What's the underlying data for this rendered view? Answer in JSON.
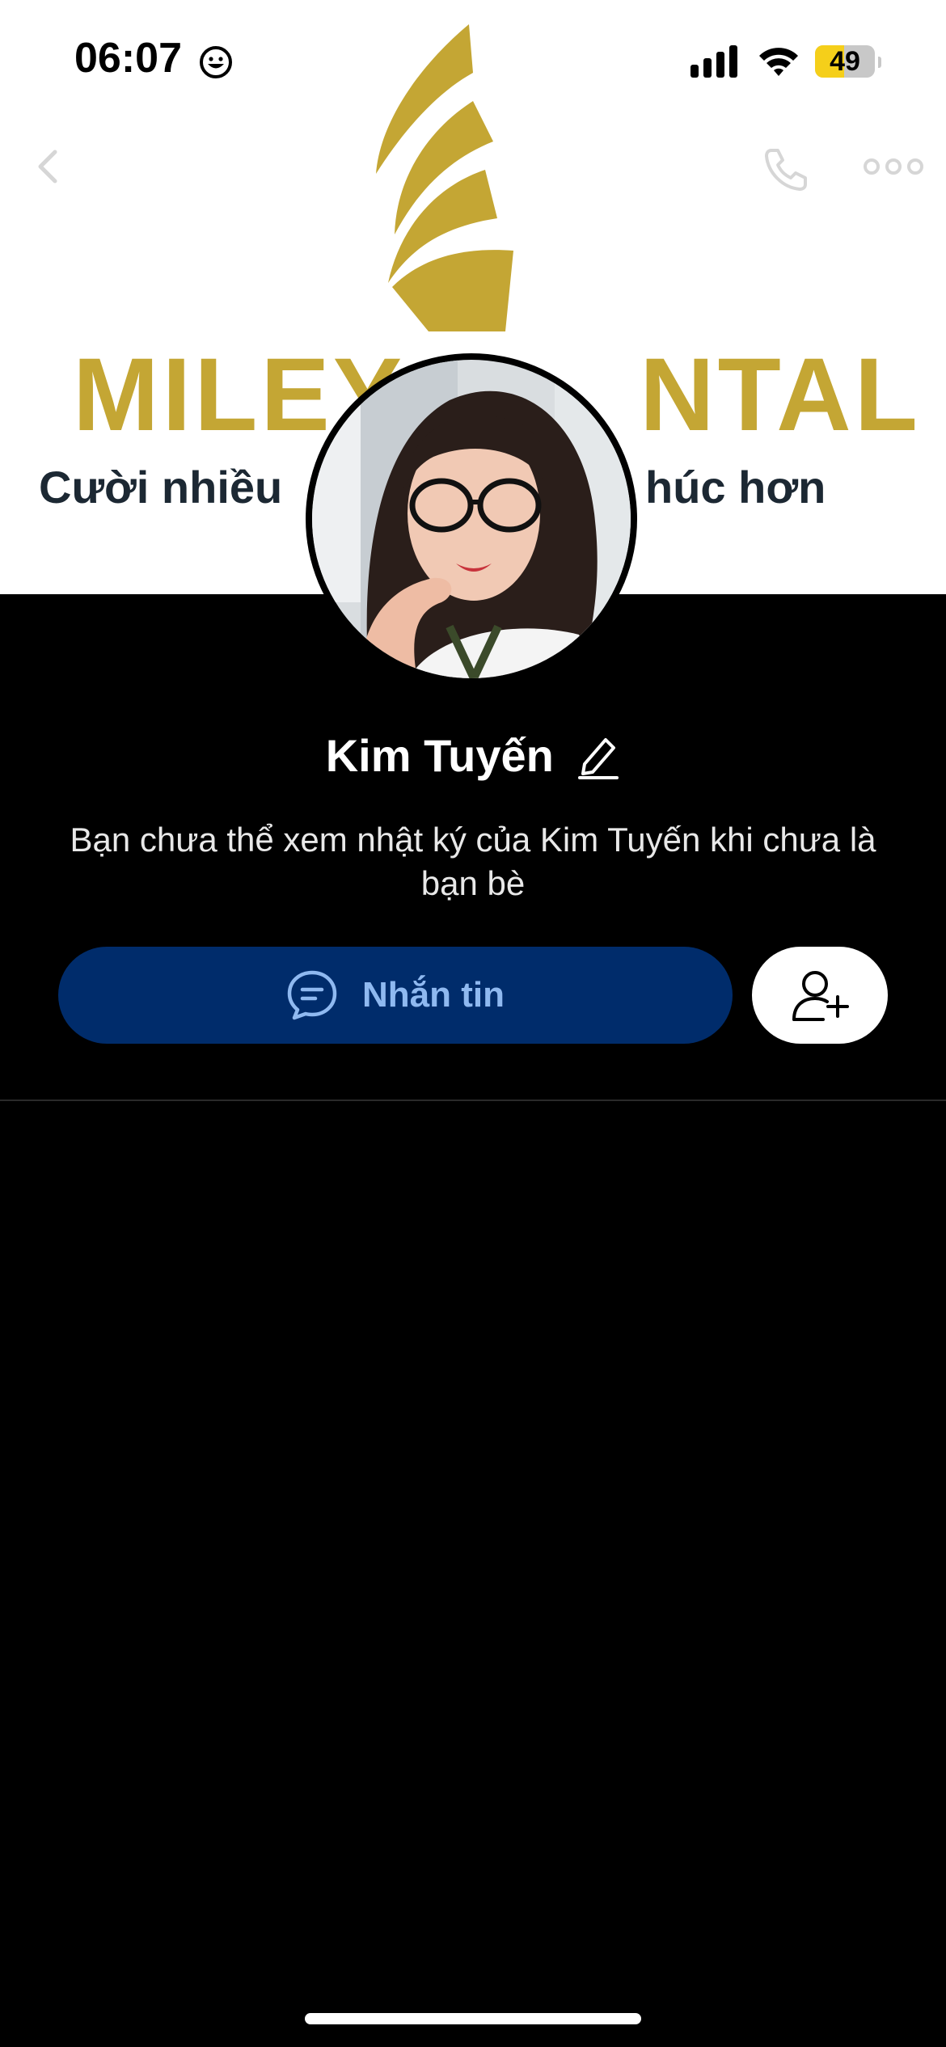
{
  "status_bar": {
    "time": "06:07",
    "battery_level": "49",
    "battery_fraction": 0.49,
    "icons": [
      "smiley-icon",
      "signal-icon",
      "wifi-icon",
      "battery-icon"
    ]
  },
  "cover": {
    "brand_text": "MILEY",
    "brand_text_right": "NTAL",
    "slogan_left": "Cười nhiều",
    "slogan_right": "húc hơn",
    "brand_color": "#c4a634"
  },
  "nav": {
    "back_icon": "chevron-left-icon",
    "call_icon": "phone-icon",
    "more_icon": "more-horizontal-icon"
  },
  "profile": {
    "name": "Kim Tuyến",
    "notice": "Bạn chưa thể xem nhật ký của Kim Tuyến khi chưa là bạn bè"
  },
  "actions": {
    "message_label": "Nhắn tin",
    "message_icon": "chat-bubble-icon",
    "add_friend_icon": "add-friend-icon",
    "message_button_color": "#002c6b",
    "message_label_color": "#8fb9f0"
  }
}
